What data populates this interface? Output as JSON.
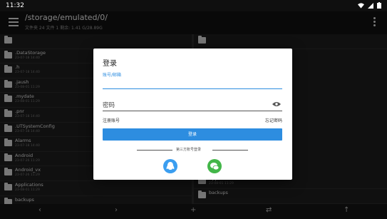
{
  "status": {
    "time": "11:32"
  },
  "appbar": {
    "path": "/storage/emulated/0/",
    "subtitle": "文件夹 24  文件 1  剩余: 1.41 G/28.89G"
  },
  "left_pane": {
    "items": [
      {
        "name": "",
        "date": ""
      },
      {
        "name": ".DataStorage",
        "date": "23-07-18 14:40"
      },
      {
        "name": ".h",
        "date": "23-07-18 14:40"
      },
      {
        "name": ".jaush",
        "date": "23-08-01 11:29"
      },
      {
        "name": ".mydate",
        "date": "23-08-01 11:29"
      },
      {
        "name": ".pnr",
        "date": "23-07-18 14:40"
      },
      {
        "name": ".UTSystemConfig",
        "date": "23-07-18 14:40"
      },
      {
        "name": "Alarms",
        "date": "23-07-18 14:40"
      },
      {
        "name": "Android",
        "date": "23-07-26 11:29"
      },
      {
        "name": "Android_vx",
        "date": "23-07-26 11:29"
      },
      {
        "name": "Applications",
        "date": "23-08-01 11:29"
      },
      {
        "name": "backups",
        "date": ""
      }
    ]
  },
  "right_pane": {
    "items": [
      {
        "name": "",
        "date": ""
      },
      {
        "name": "Applications",
        "date": "23-08-01 11:29"
      },
      {
        "name": "backups",
        "date": ""
      }
    ]
  },
  "bottombar": {
    "left": "‹",
    "forward": "›",
    "add": "+",
    "swap": "⇄",
    "up": "↑"
  },
  "dialog": {
    "title": "登录",
    "username_hint": "账号/邮箱",
    "password_label": "密码",
    "register_label": "注册账号",
    "forgot_label": "忘记密码",
    "login_label": "登录",
    "third_party_label": "第三方账号登录"
  },
  "colors": {
    "accent": "#2d8de0",
    "qq": "#3b9ef0",
    "wechat": "#43b649"
  }
}
